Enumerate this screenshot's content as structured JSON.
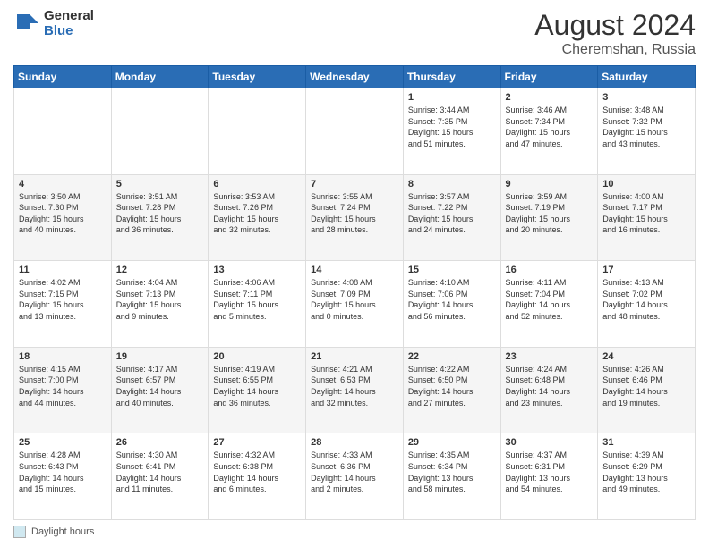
{
  "logo": {
    "general": "General",
    "blue": "Blue"
  },
  "header": {
    "month_year": "August 2024",
    "location": "Cheremshan, Russia"
  },
  "weekdays": [
    "Sunday",
    "Monday",
    "Tuesday",
    "Wednesday",
    "Thursday",
    "Friday",
    "Saturday"
  ],
  "footer": {
    "label": "Daylight hours"
  },
  "weeks": [
    [
      {
        "day": "",
        "info": ""
      },
      {
        "day": "",
        "info": ""
      },
      {
        "day": "",
        "info": ""
      },
      {
        "day": "",
        "info": ""
      },
      {
        "day": "1",
        "info": "Sunrise: 3:44 AM\nSunset: 7:35 PM\nDaylight: 15 hours\nand 51 minutes."
      },
      {
        "day": "2",
        "info": "Sunrise: 3:46 AM\nSunset: 7:34 PM\nDaylight: 15 hours\nand 47 minutes."
      },
      {
        "day": "3",
        "info": "Sunrise: 3:48 AM\nSunset: 7:32 PM\nDaylight: 15 hours\nand 43 minutes."
      }
    ],
    [
      {
        "day": "4",
        "info": "Sunrise: 3:50 AM\nSunset: 7:30 PM\nDaylight: 15 hours\nand 40 minutes."
      },
      {
        "day": "5",
        "info": "Sunrise: 3:51 AM\nSunset: 7:28 PM\nDaylight: 15 hours\nand 36 minutes."
      },
      {
        "day": "6",
        "info": "Sunrise: 3:53 AM\nSunset: 7:26 PM\nDaylight: 15 hours\nand 32 minutes."
      },
      {
        "day": "7",
        "info": "Sunrise: 3:55 AM\nSunset: 7:24 PM\nDaylight: 15 hours\nand 28 minutes."
      },
      {
        "day": "8",
        "info": "Sunrise: 3:57 AM\nSunset: 7:22 PM\nDaylight: 15 hours\nand 24 minutes."
      },
      {
        "day": "9",
        "info": "Sunrise: 3:59 AM\nSunset: 7:19 PM\nDaylight: 15 hours\nand 20 minutes."
      },
      {
        "day": "10",
        "info": "Sunrise: 4:00 AM\nSunset: 7:17 PM\nDaylight: 15 hours\nand 16 minutes."
      }
    ],
    [
      {
        "day": "11",
        "info": "Sunrise: 4:02 AM\nSunset: 7:15 PM\nDaylight: 15 hours\nand 13 minutes."
      },
      {
        "day": "12",
        "info": "Sunrise: 4:04 AM\nSunset: 7:13 PM\nDaylight: 15 hours\nand 9 minutes."
      },
      {
        "day": "13",
        "info": "Sunrise: 4:06 AM\nSunset: 7:11 PM\nDaylight: 15 hours\nand 5 minutes."
      },
      {
        "day": "14",
        "info": "Sunrise: 4:08 AM\nSunset: 7:09 PM\nDaylight: 15 hours\nand 0 minutes."
      },
      {
        "day": "15",
        "info": "Sunrise: 4:10 AM\nSunset: 7:06 PM\nDaylight: 14 hours\nand 56 minutes."
      },
      {
        "day": "16",
        "info": "Sunrise: 4:11 AM\nSunset: 7:04 PM\nDaylight: 14 hours\nand 52 minutes."
      },
      {
        "day": "17",
        "info": "Sunrise: 4:13 AM\nSunset: 7:02 PM\nDaylight: 14 hours\nand 48 minutes."
      }
    ],
    [
      {
        "day": "18",
        "info": "Sunrise: 4:15 AM\nSunset: 7:00 PM\nDaylight: 14 hours\nand 44 minutes."
      },
      {
        "day": "19",
        "info": "Sunrise: 4:17 AM\nSunset: 6:57 PM\nDaylight: 14 hours\nand 40 minutes."
      },
      {
        "day": "20",
        "info": "Sunrise: 4:19 AM\nSunset: 6:55 PM\nDaylight: 14 hours\nand 36 minutes."
      },
      {
        "day": "21",
        "info": "Sunrise: 4:21 AM\nSunset: 6:53 PM\nDaylight: 14 hours\nand 32 minutes."
      },
      {
        "day": "22",
        "info": "Sunrise: 4:22 AM\nSunset: 6:50 PM\nDaylight: 14 hours\nand 27 minutes."
      },
      {
        "day": "23",
        "info": "Sunrise: 4:24 AM\nSunset: 6:48 PM\nDaylight: 14 hours\nand 23 minutes."
      },
      {
        "day": "24",
        "info": "Sunrise: 4:26 AM\nSunset: 6:46 PM\nDaylight: 14 hours\nand 19 minutes."
      }
    ],
    [
      {
        "day": "25",
        "info": "Sunrise: 4:28 AM\nSunset: 6:43 PM\nDaylight: 14 hours\nand 15 minutes."
      },
      {
        "day": "26",
        "info": "Sunrise: 4:30 AM\nSunset: 6:41 PM\nDaylight: 14 hours\nand 11 minutes."
      },
      {
        "day": "27",
        "info": "Sunrise: 4:32 AM\nSunset: 6:38 PM\nDaylight: 14 hours\nand 6 minutes."
      },
      {
        "day": "28",
        "info": "Sunrise: 4:33 AM\nSunset: 6:36 PM\nDaylight: 14 hours\nand 2 minutes."
      },
      {
        "day": "29",
        "info": "Sunrise: 4:35 AM\nSunset: 6:34 PM\nDaylight: 13 hours\nand 58 minutes."
      },
      {
        "day": "30",
        "info": "Sunrise: 4:37 AM\nSunset: 6:31 PM\nDaylight: 13 hours\nand 54 minutes."
      },
      {
        "day": "31",
        "info": "Sunrise: 4:39 AM\nSunset: 6:29 PM\nDaylight: 13 hours\nand 49 minutes."
      }
    ]
  ]
}
